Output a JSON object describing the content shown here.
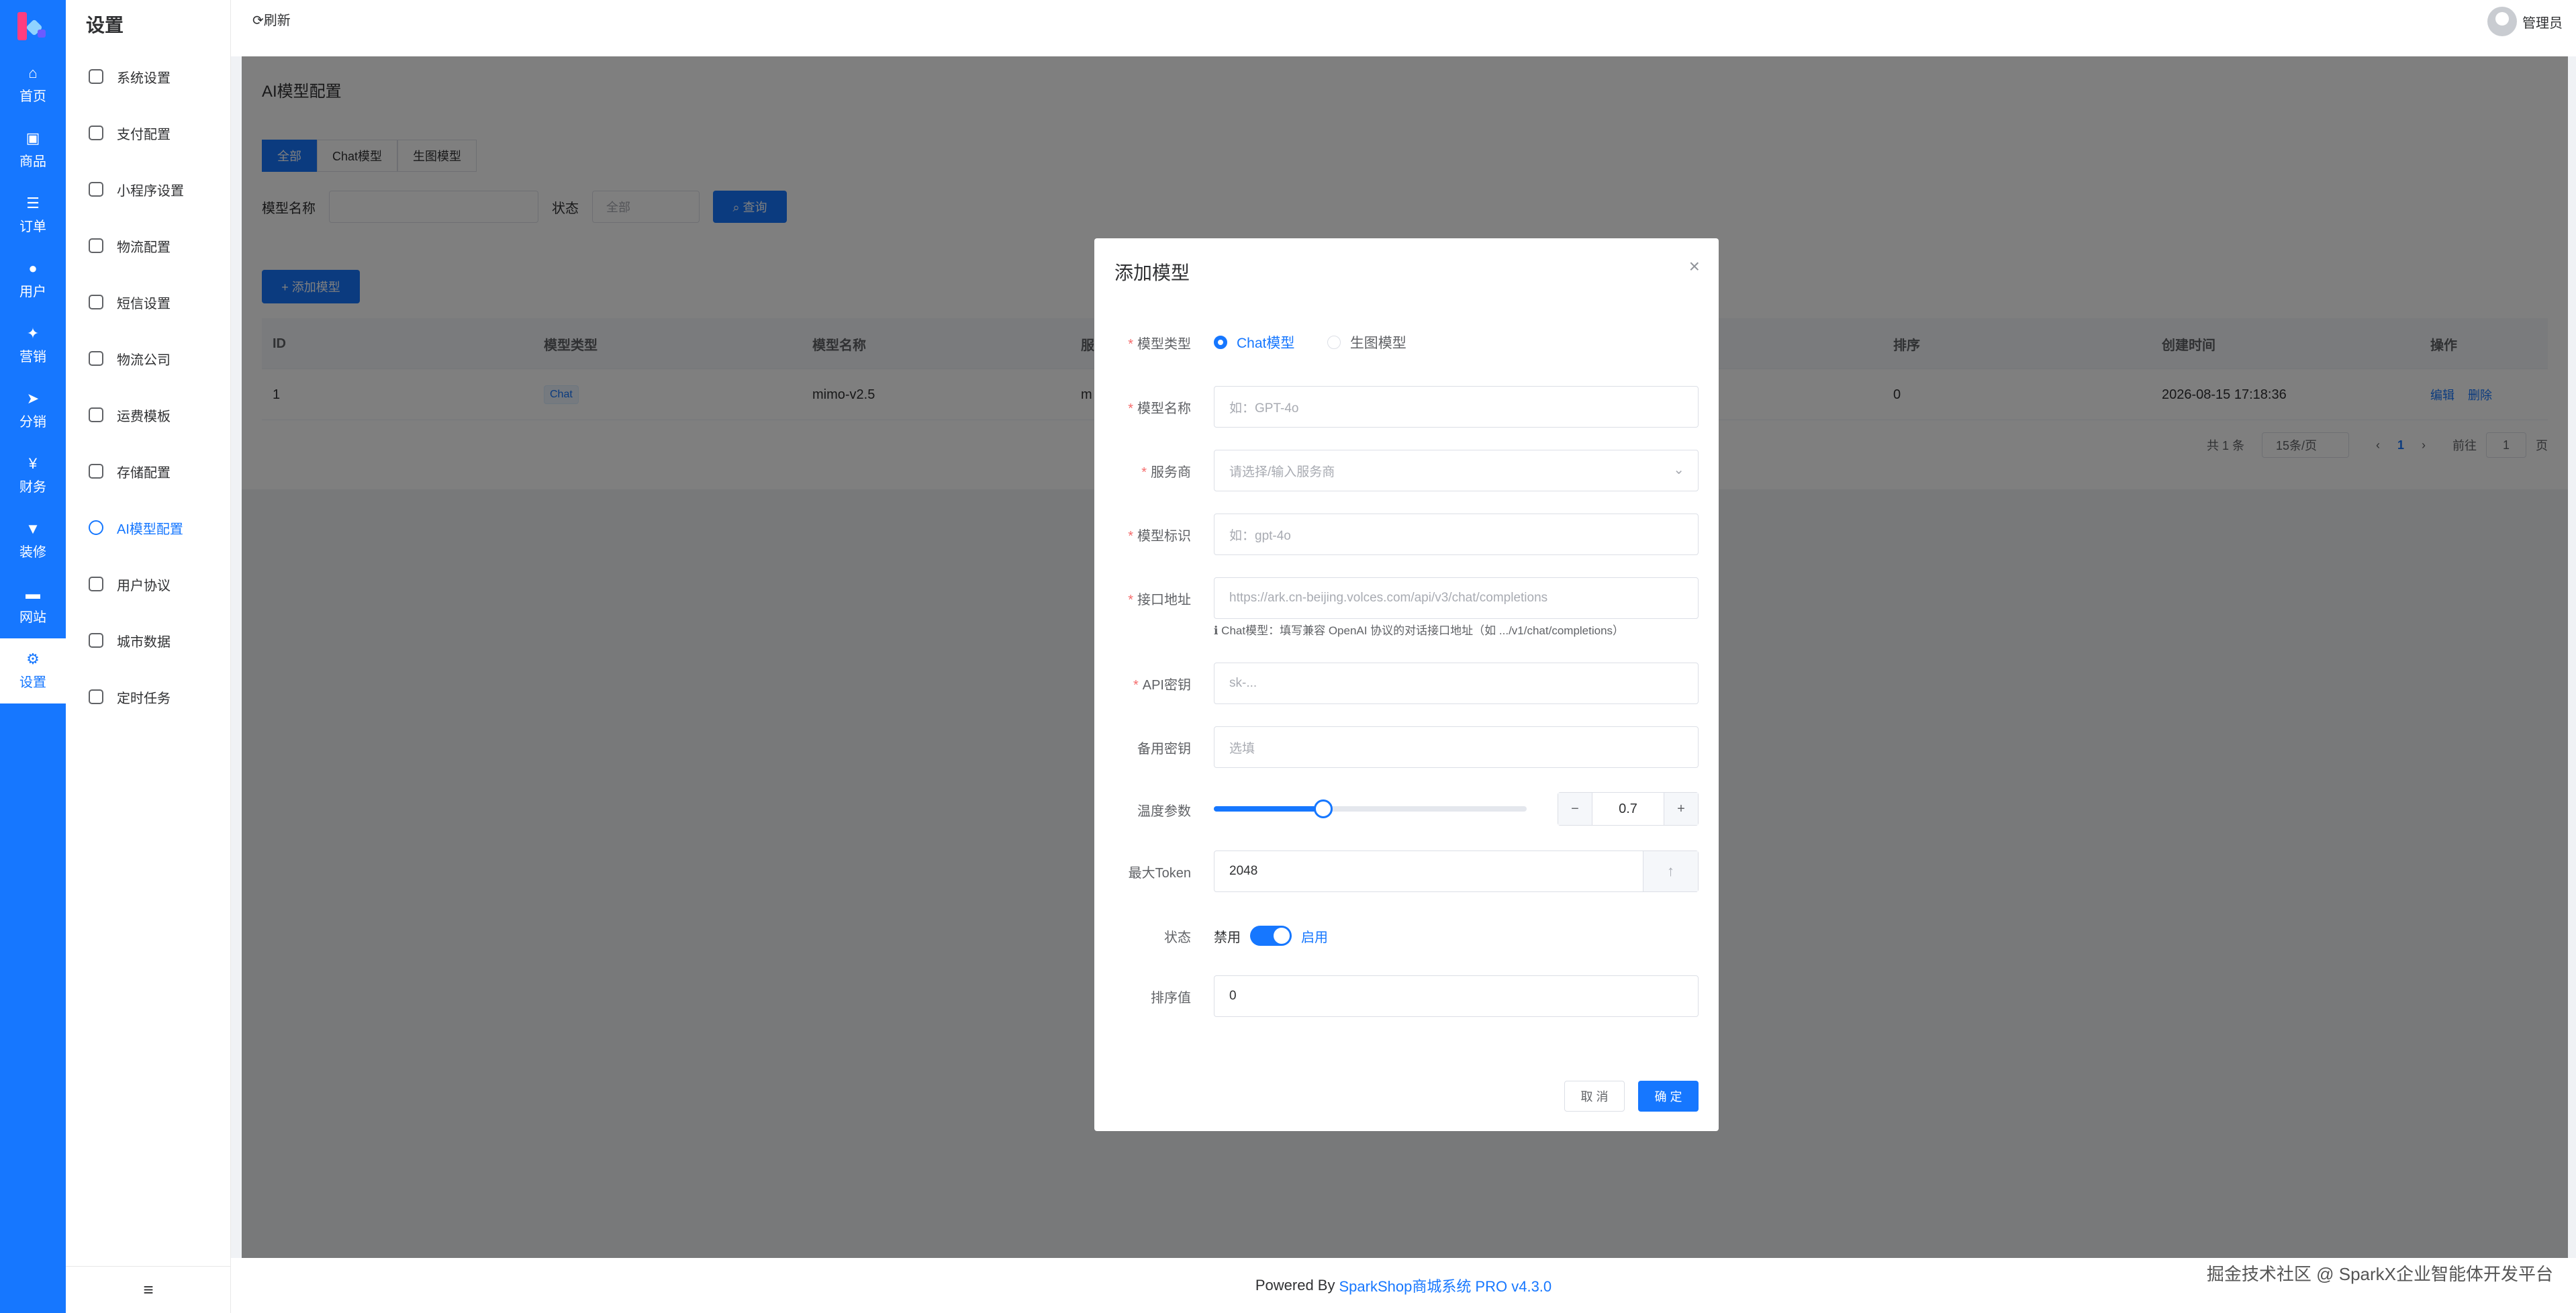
{
  "rail": {
    "items": [
      {
        "label": "首页",
        "icon": "home-icon",
        "glyph": "⌂"
      },
      {
        "label": "商品",
        "icon": "bag-icon",
        "glyph": "▣"
      },
      {
        "label": "订单",
        "icon": "order-icon",
        "glyph": "☰"
      },
      {
        "label": "用户",
        "icon": "user-icon",
        "glyph": "●"
      },
      {
        "label": "营销",
        "icon": "marketing-icon",
        "glyph": "✦"
      },
      {
        "label": "分销",
        "icon": "send-icon",
        "glyph": "➤"
      },
      {
        "label": "财务",
        "icon": "finance-icon",
        "glyph": "¥"
      },
      {
        "label": "装修",
        "icon": "brush-icon",
        "glyph": "▼"
      },
      {
        "label": "网站",
        "icon": "website-icon",
        "glyph": "▬"
      },
      {
        "label": "设置",
        "icon": "gear-icon",
        "glyph": "⚙",
        "active": true
      }
    ]
  },
  "submenu": {
    "title": "设置",
    "items": [
      {
        "label": "系统设置"
      },
      {
        "label": "支付配置"
      },
      {
        "label": "小程序设置"
      },
      {
        "label": "物流配置"
      },
      {
        "label": "短信设置"
      },
      {
        "label": "物流公司"
      },
      {
        "label": "运费模板"
      },
      {
        "label": "存储配置"
      },
      {
        "label": "AI模型配置",
        "active": true
      },
      {
        "label": "用户协议"
      },
      {
        "label": "城市数据"
      },
      {
        "label": "定时任务"
      }
    ],
    "collapse_glyph": "≡"
  },
  "topbar": {
    "refresh": "⟳刷新",
    "user_name": "管理员"
  },
  "page": {
    "title": "AI模型配置",
    "tabs": [
      "全部",
      "Chat模型",
      "生图模型"
    ],
    "filter_model_name_label": "模型名称",
    "filter_status_label": "状态",
    "filter_status_value": "全部",
    "query_button": "⌕ 查询",
    "add_button": "+ 添加模型",
    "table": {
      "headers": [
        "ID",
        "模型类型",
        "模型名称",
        "服务商",
        "排序",
        "创建时间",
        "操作"
      ],
      "rows": [
        {
          "id": "1",
          "type": "Chat",
          "name": "mimo-v2.5",
          "provider": "m",
          "sort": "0",
          "created": "2026-08-15 17:18:36",
          "edit": "编辑",
          "delete": "删除"
        }
      ]
    },
    "pager": {
      "total": "共 1 条",
      "page_size": "15条/页",
      "prev": "‹",
      "current": "1",
      "next": "›",
      "goto_label": "前往",
      "goto_value": "1",
      "page_suffix": "页"
    }
  },
  "modal": {
    "title": "添加模型",
    "close": "×",
    "type_label": "模型类型",
    "type_options": [
      "Chat模型",
      "生图模型"
    ],
    "name_label": "模型名称",
    "name_placeholder": "如：GPT-4o",
    "provider_label": "服务商",
    "provider_placeholder": "请选择/输入服务商",
    "ident_label": "模型标识",
    "ident_placeholder": "如：gpt-4o",
    "endpoint_label": "接口地址",
    "endpoint_placeholder": "https://ark.cn-beijing.volces.com/api/v3/chat/completions",
    "endpoint_hint": "ℹ Chat模型：填写兼容 OpenAI 协议的对话接口地址（如 .../v1/chat/completions）",
    "apikey_label": "API密钥",
    "apikey_placeholder": "sk-...",
    "backup_label": "备用密钥",
    "backup_placeholder": "选填",
    "temp_label": "温度参数",
    "temp_value": "0.7",
    "temp_fraction": 0.35,
    "temp_minus": "−",
    "temp_plus": "+",
    "token_label": "最大Token",
    "token_value": "2048",
    "status_label": "状态",
    "status_off": "禁用",
    "status_on": "启用",
    "sort_label": "排序值",
    "sort_value": "0",
    "cancel": "取 消",
    "confirm": "确 定"
  },
  "footer": {
    "powered": "Powered By",
    "brand": "SparkShop商城系统 PRO v4.3.0"
  },
  "watermark": "掘金技术社区 @ SparkX企业智能体开发平台",
  "colors": {
    "primary": "#1677ff",
    "danger": "#f56c6c"
  }
}
